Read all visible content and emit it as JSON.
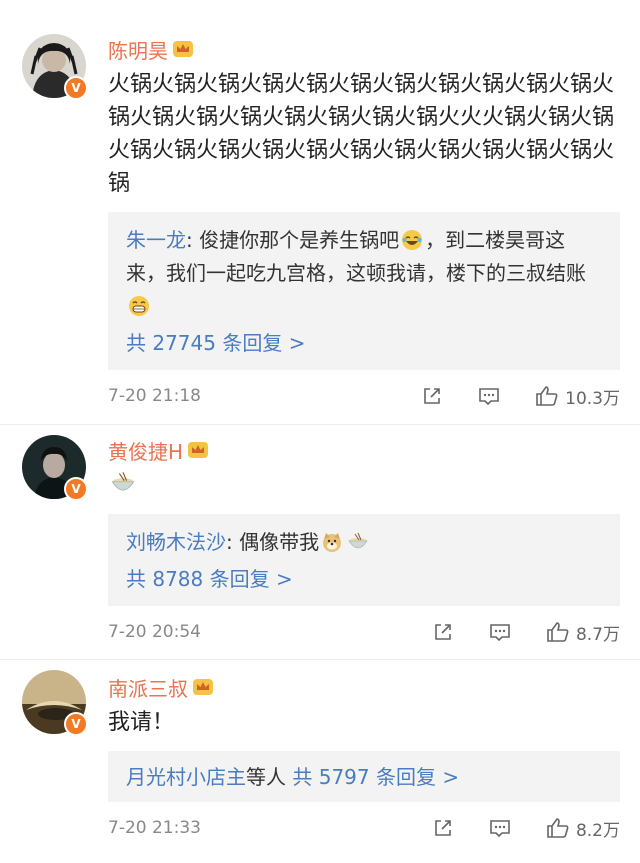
{
  "comments": [
    {
      "username": "陈明昊",
      "text": "火锅火锅火锅火锅火锅火锅火锅火锅火锅火锅火锅火锅火锅火锅火锅火锅火锅火锅火锅火火火锅火锅火锅火锅火锅火锅火锅火锅火锅火锅火锅火锅火锅火锅火锅",
      "reply_user": "朱一龙",
      "reply_text_a": "俊捷你那个是养生锅吧",
      "reply_text_b": "，到二楼昊哥这来，我们一起吃九宫格，这顿我请，楼下的三叔结账",
      "reply_more": "共 27745 条回复 >",
      "time": "7-20 21:18",
      "likes": "10.3万"
    },
    {
      "username": "黄俊捷H",
      "reply_user": "刘畅木法沙",
      "reply_text_a": "偶像带我",
      "reply_more": "共 8788 条回复 >",
      "time": "7-20 20:54",
      "likes": "8.7万"
    },
    {
      "username": "南派三叔",
      "text": "我请！",
      "reply_user": "月光村小店主",
      "reply_mid": "等人",
      "reply_more": "共 5797 条回复 >",
      "time": "7-20 21:33",
      "likes": "8.2万"
    }
  ],
  "verified_badge": "V",
  "icons": [
    "share-icon",
    "comment-icon",
    "like-icon",
    "crown-icon",
    "verified-badge-icon",
    "noodle-bowl-emoji",
    "laugh-cry-emoji",
    "grin-emoji",
    "doge-emoji"
  ],
  "colors": {
    "username": "#eb7350",
    "link": "#4a7cbf",
    "badge": "#f27a24",
    "reply_bg": "#f3f3f3"
  }
}
